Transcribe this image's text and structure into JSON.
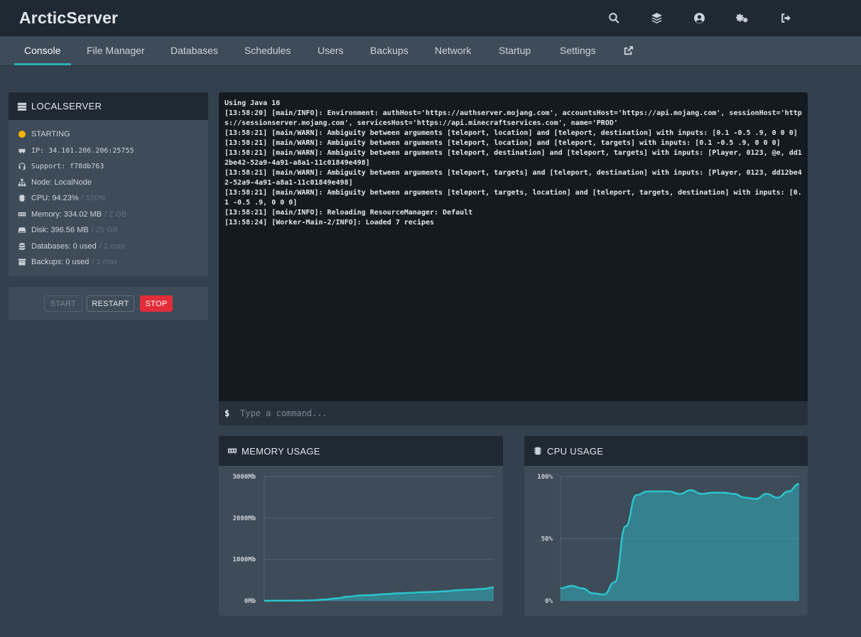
{
  "app": {
    "title": "ArcticServer"
  },
  "top_icons": [
    "search-icon",
    "layers-icon",
    "account-icon",
    "settings-icon",
    "logout-icon"
  ],
  "tabs": [
    {
      "label": "Console",
      "active": true
    },
    {
      "label": "File Manager"
    },
    {
      "label": "Databases"
    },
    {
      "label": "Schedules"
    },
    {
      "label": "Users"
    },
    {
      "label": "Backups"
    },
    {
      "label": "Network"
    },
    {
      "label": "Startup"
    },
    {
      "label": "Settings"
    }
  ],
  "server": {
    "name": "LOCALSERVER",
    "status": "STARTING",
    "status_color": "#f5b300",
    "ip": "IP: 34.101.206.206:25755",
    "support": "Support: f78db763",
    "node": "Node: LocalNode",
    "cpu": "CPU: 94.23%",
    "cpu_limit": "/ 100%",
    "memory": "Memory: 334.02 MB",
    "memory_limit": "/ 2 GB",
    "disk": "Disk: 396.56 MB",
    "disk_limit": "/ 25 GB",
    "databases": "Databases: 0 used",
    "databases_limit": "/ 1 max",
    "backups": "Backups: 0 used",
    "backups_limit": "/ 1 max"
  },
  "power": {
    "start": "START",
    "restart": "RESTART",
    "stop": "STOP",
    "stop_color": "#e12d39"
  },
  "console": {
    "lines": [
      "Using Java 16",
      "[13:58:20] [main/INFO]: Environment: authHost='https://authserver.mojang.com', accountsHost='https://api.mojang.com', sessionHost='https://sessionserver.mojang.com', servicesHost='https://api.minecraftservices.com', name='PROD'",
      "[13:58:21] [main/WARN]: Ambiguity between arguments [teleport, location] and [teleport, destination] with inputs: [0.1 -0.5 .9, 0 0 0]",
      "[13:58:21] [main/WARN]: Ambiguity between arguments [teleport, location] and [teleport, targets] with inputs: [0.1 -0.5 .9, 0 0 0]",
      "[13:58:21] [main/WARN]: Ambiguity between arguments [teleport, destination] and [teleport, targets] with inputs: [Player, 0123, @e, dd12be42-52a9-4a91-a8a1-11c01849e498]",
      "[13:58:21] [main/WARN]: Ambiguity between arguments [teleport, targets] and [teleport, destination] with inputs: [Player, 0123, dd12be42-52a9-4a91-a8a1-11c01849e498]",
      "[13:58:21] [main/WARN]: Ambiguity between arguments [teleport, targets, location] and [teleport, targets, destination] with inputs: [0.1 -0.5 .9, 0 0 0]",
      "[13:58:21] [main/INFO]: Reloading ResourceManager: Default",
      "[13:58:24] [Worker-Main-2/INFO]: Loaded 7 recipes"
    ],
    "prompt": "$",
    "placeholder": "Type a command..."
  },
  "chart_data": [
    {
      "type": "area",
      "title": "MEMORY USAGE",
      "ylim": [
        0,
        3000
      ],
      "yticks": [
        "3000Mb",
        "2000Mb",
        "1000Mb",
        "0Mb"
      ],
      "ytick_values": [
        3000,
        2000,
        1000,
        0
      ],
      "color": "#2bc4cc",
      "values": [
        0,
        2,
        3,
        5,
        10,
        30,
        60,
        100,
        130,
        140,
        160,
        180,
        190,
        205,
        215,
        230,
        255,
        270,
        285,
        320
      ]
    },
    {
      "type": "area",
      "title": "CPU USAGE",
      "ylim": [
        0,
        100
      ],
      "yticks": [
        "100%",
        "50%",
        "0%"
      ],
      "ytick_values": [
        100,
        50,
        0
      ],
      "color": "#2bc4cc",
      "values": [
        10,
        12,
        10,
        6,
        5,
        15,
        60,
        85,
        88,
        88,
        88,
        86,
        89,
        86,
        87,
        87,
        86,
        83,
        82,
        86,
        83,
        88,
        94
      ]
    }
  ]
}
